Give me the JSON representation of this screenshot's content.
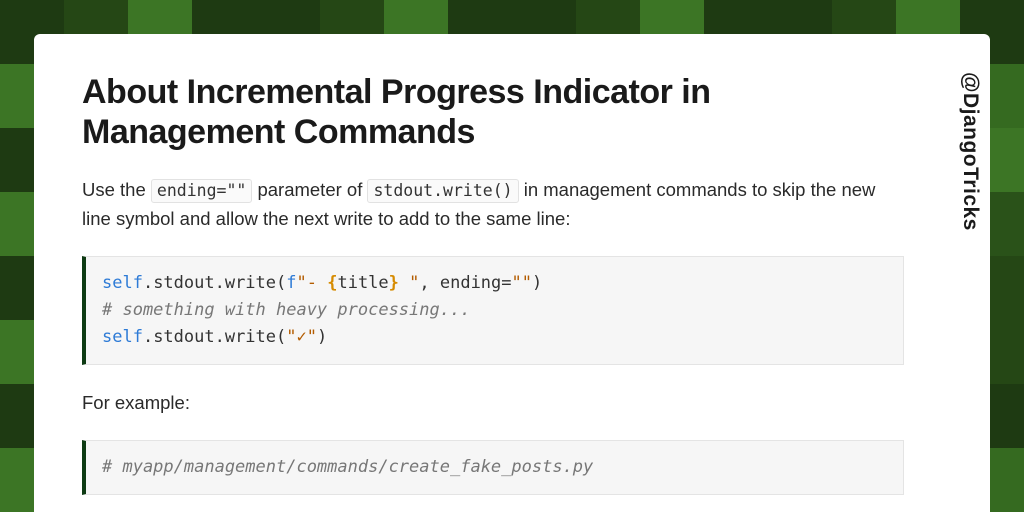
{
  "handle": "@DjangoTricks",
  "title": "About Incremental Progress Indicator in Management Commands",
  "intro": {
    "pre": "Use the ",
    "code1": "ending=\"\"",
    "mid": " parameter of ",
    "code2": "stdout.write()",
    "post": " in management commands to skip the new line symbol and allow the next write to add to the same line:"
  },
  "code1": {
    "l1_self": "self",
    "l1_call": ".stdout.write(",
    "l1_f": "f",
    "l1_q1": "\"- ",
    "l1_ob": "{",
    "l1_var": "title",
    "l1_cb": "}",
    "l1_q2": " \"",
    "l1_after": ", ending=",
    "l1_empty": "\"\"",
    "l1_close": ")",
    "l2_comment": "# something with heavy processing...",
    "l3_self": "self",
    "l3_call": ".stdout.write(",
    "l3_str": "\"✓\"",
    "l3_close": ")"
  },
  "for_example": "For example:",
  "code2": {
    "l1_comment": "# myapp/management/commands/create_fake_posts.py"
  }
}
